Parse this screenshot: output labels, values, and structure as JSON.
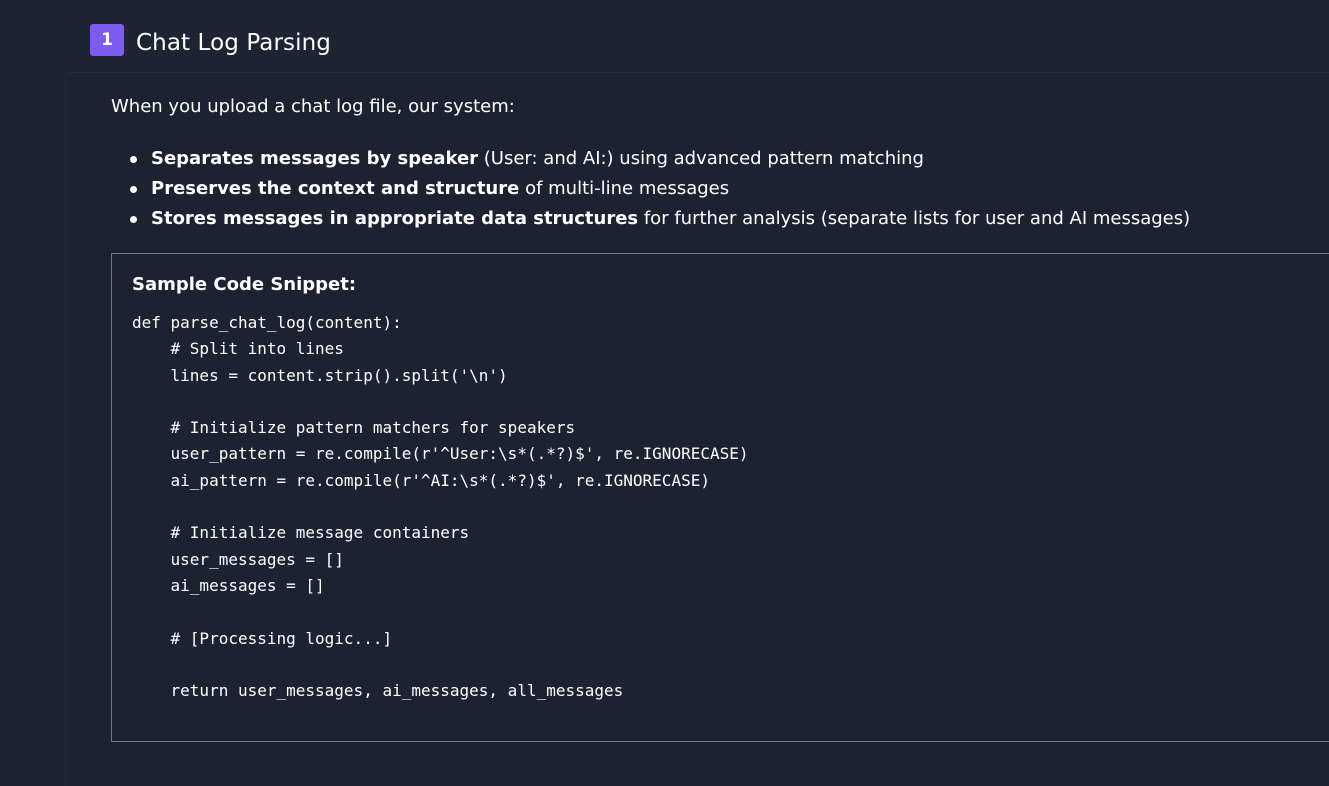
{
  "section": {
    "step_number": "1",
    "title": "Chat Log Parsing"
  },
  "intro": "When you upload a chat log file, our system:",
  "features": [
    {
      "bold": "Separates messages by speaker",
      "text": " (User: and AI:) using advanced pattern matching"
    },
    {
      "bold": "Preserves the context and structure",
      "text": " of multi-line messages"
    },
    {
      "bold": "Stores messages in appropriate data structures",
      "text": " for further analysis (separate lists for user and AI messages)"
    }
  ],
  "code": {
    "title": "Sample Code Snippet:",
    "content": "def parse_chat_log(content):\n    # Split into lines\n    lines = content.strip().split('\\n')\n\n    # Initialize pattern matchers for speakers\n    user_pattern = re.compile(r'^User:\\s*(.*?)$', re.IGNORECASE)\n    ai_pattern = re.compile(r'^AI:\\s*(.*?)$', re.IGNORECASE)\n\n    # Initialize message containers\n    user_messages = []\n    ai_messages = []\n\n    # [Processing logic...]\n\n    return user_messages, ai_messages, all_messages"
  },
  "colors": {
    "background": "#1e2434",
    "badge": "#7c5cf2",
    "code_border": "#6e7585",
    "text": "#ffffff"
  }
}
